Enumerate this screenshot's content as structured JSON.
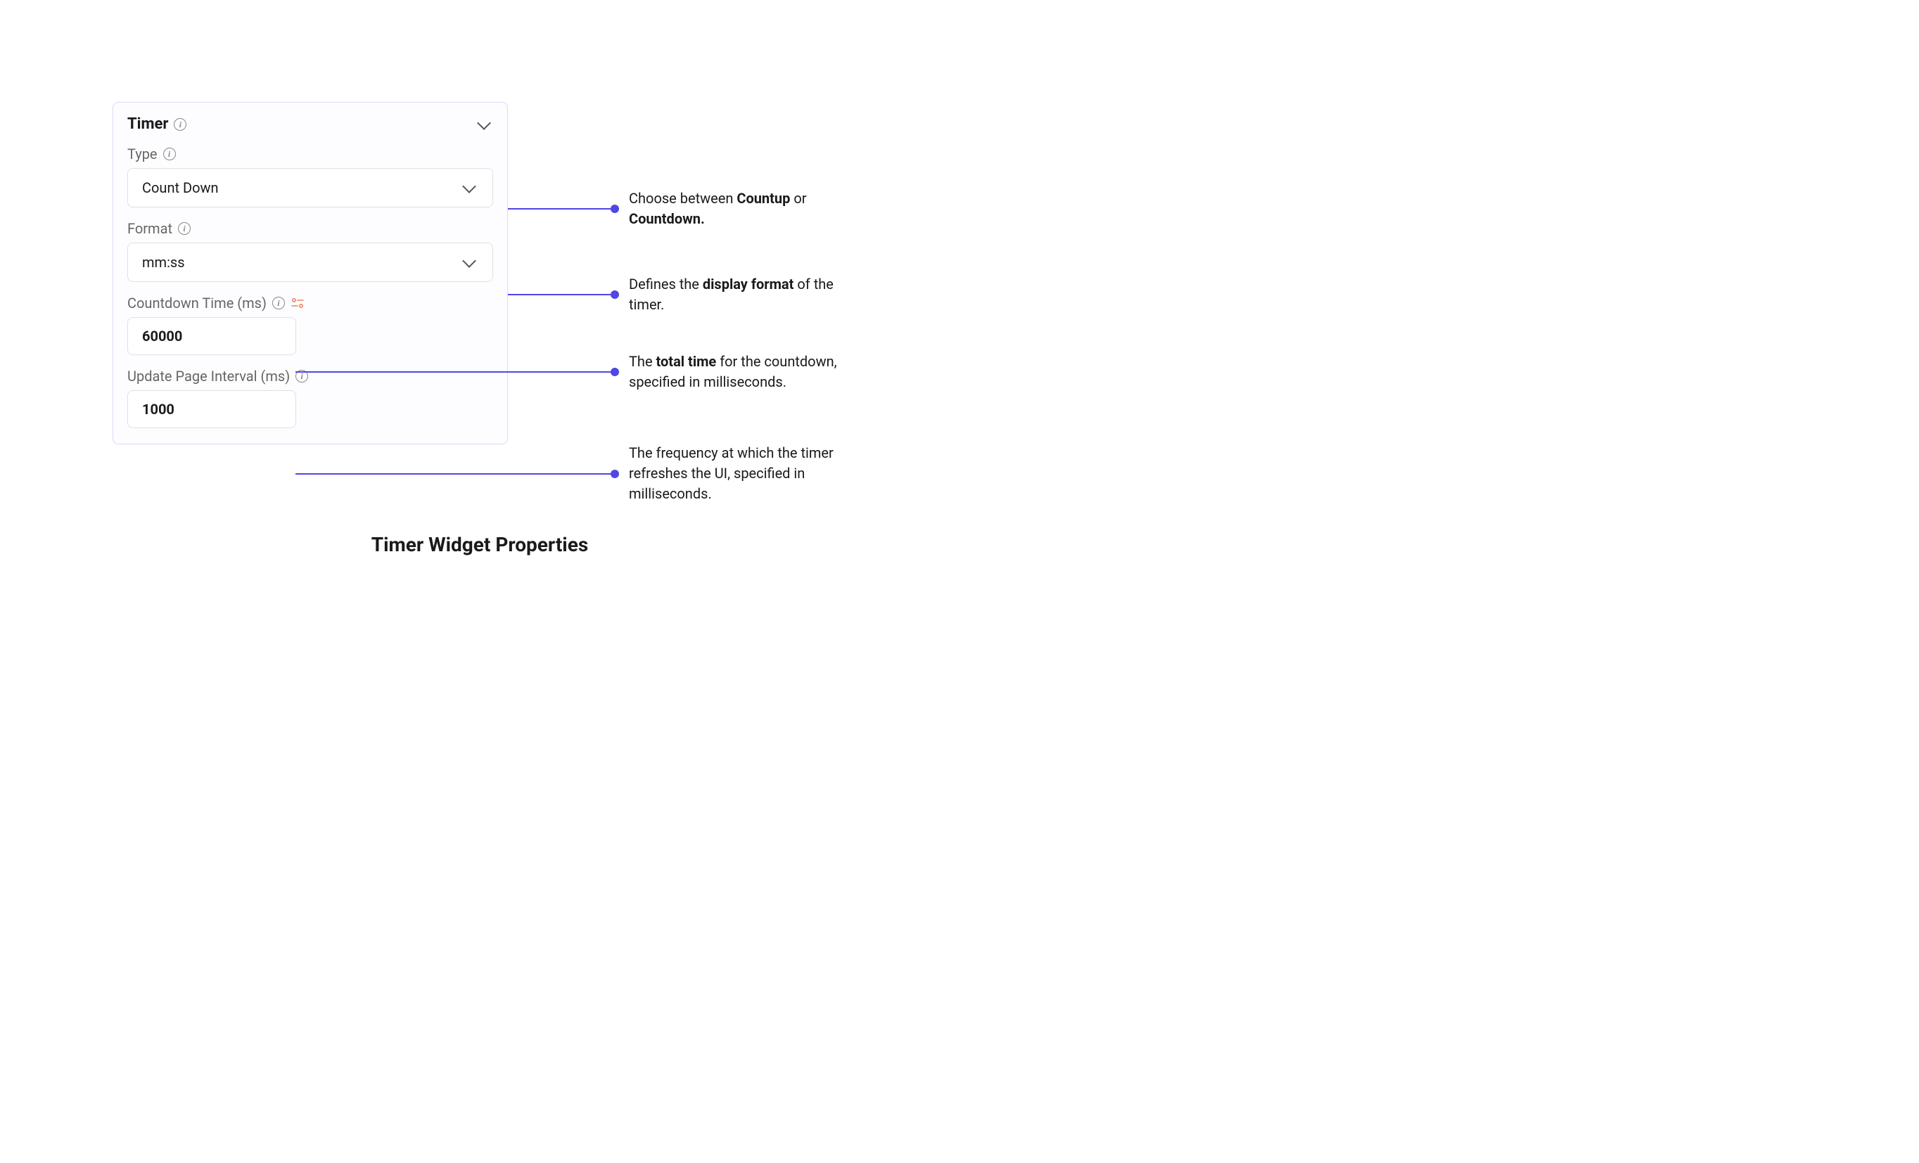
{
  "panel": {
    "title": "Timer",
    "fields": {
      "type": {
        "label": "Type",
        "value": "Count Down"
      },
      "format": {
        "label": "Format",
        "value": "mm:ss"
      },
      "countdown_time": {
        "label": "Countdown Time (ms)",
        "value": "60000"
      },
      "update_interval": {
        "label": "Update Page Interval (ms)",
        "value": "1000"
      }
    }
  },
  "annotations": {
    "type": {
      "pre": "Choose between ",
      "bold1": "Countup",
      "mid": " or ",
      "bold2": "Countdown."
    },
    "format": {
      "pre": "Defines the ",
      "bold1": "display format",
      "post": " of the timer."
    },
    "countdown_time": {
      "pre": "The ",
      "bold1": "total time",
      "post": " for the countdown, specified in milliseconds."
    },
    "update_interval": {
      "text": "The frequency at which the timer refreshes the UI, specified in milliseconds."
    }
  },
  "caption": "Timer Widget Properties"
}
